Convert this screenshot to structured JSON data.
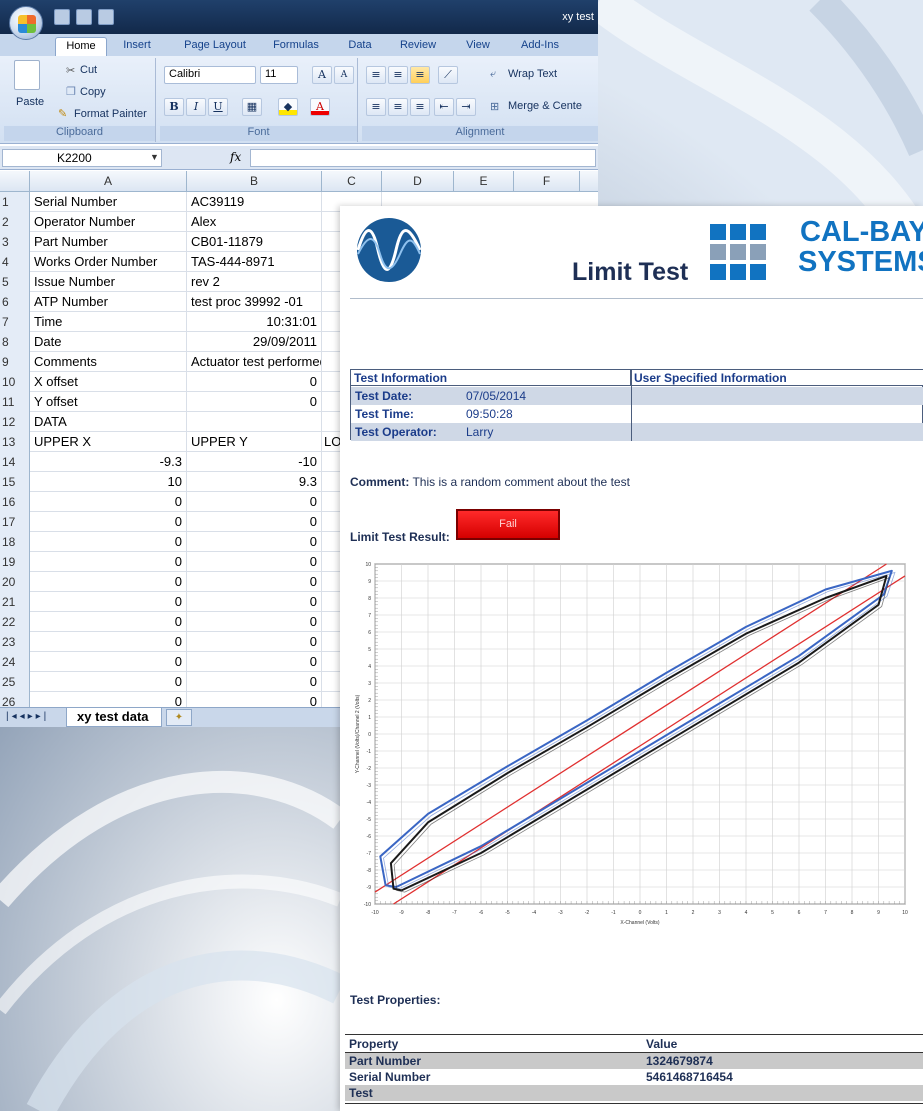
{
  "window": {
    "title": "xy test"
  },
  "ribbon": {
    "tabs": [
      "Home",
      "Insert",
      "Page Layout",
      "Formulas",
      "Data",
      "Review",
      "View",
      "Add-Ins"
    ],
    "clipboard": {
      "paste": "Paste",
      "cut": "Cut",
      "copy": "Copy",
      "format_painter": "Format Painter",
      "caption": "Clipboard"
    },
    "font": {
      "name": "Calibri",
      "size": "11",
      "caption": "Font"
    },
    "alignment": {
      "wrap_text": "Wrap Text",
      "merge": "Merge & Cente",
      "caption": "Alignment"
    }
  },
  "formula_bar": {
    "name_box": "K2200",
    "fx": "fx",
    "value": ""
  },
  "columns": [
    "A",
    "B",
    "C",
    "D",
    "E",
    "F"
  ],
  "rows": [
    {
      "n": "1",
      "a": "Serial Number",
      "b": "AC39119",
      "c": ""
    },
    {
      "n": "2",
      "a": "Operator Number",
      "b": "Alex",
      "c": ""
    },
    {
      "n": "3",
      "a": "Part Number",
      "b": "CB01-11879",
      "c": ""
    },
    {
      "n": "4",
      "a": "Works Order Number",
      "b": "TAS-444-8971",
      "c": ""
    },
    {
      "n": "5",
      "a": "Issue Number",
      "b": "rev 2",
      "c": ""
    },
    {
      "n": "6",
      "a": "ATP Number",
      "b": "test proc 39992 -01",
      "c": ""
    },
    {
      "n": "7",
      "a": "Time",
      "b": "10:31:01",
      "c": ""
    },
    {
      "n": "8",
      "a": "Date",
      "b": "29/09/2011",
      "c": ""
    },
    {
      "n": "9",
      "a": "Comments",
      "b": "Actuator test performed",
      "c": ""
    },
    {
      "n": "10",
      "a": "X offset",
      "b": "0",
      "c": ""
    },
    {
      "n": "11",
      "a": "Y offset",
      "b": "0",
      "c": ""
    },
    {
      "n": "12",
      "a": "DATA",
      "b": "",
      "c": ""
    },
    {
      "n": "13",
      "a": "UPPER X",
      "b": "UPPER Y",
      "c": "LO"
    },
    {
      "n": "14",
      "a": "-9.3",
      "b": "-10",
      "c": ""
    },
    {
      "n": "15",
      "a": "10",
      "b": "9.3",
      "c": ""
    },
    {
      "n": "16",
      "a": "0",
      "b": "0",
      "c": ""
    },
    {
      "n": "17",
      "a": "0",
      "b": "0",
      "c": ""
    },
    {
      "n": "18",
      "a": "0",
      "b": "0",
      "c": ""
    },
    {
      "n": "19",
      "a": "0",
      "b": "0",
      "c": ""
    },
    {
      "n": "20",
      "a": "0",
      "b": "0",
      "c": ""
    },
    {
      "n": "21",
      "a": "0",
      "b": "0",
      "c": ""
    },
    {
      "n": "22",
      "a": "0",
      "b": "0",
      "c": ""
    },
    {
      "n": "23",
      "a": "0",
      "b": "0",
      "c": ""
    },
    {
      "n": "24",
      "a": "0",
      "b": "0",
      "c": ""
    },
    {
      "n": "25",
      "a": "0",
      "b": "0",
      "c": ""
    },
    {
      "n": "26",
      "a": "0",
      "b": "0",
      "c": ""
    }
  ],
  "sheet_tab": "xy test data",
  "report": {
    "title": "Limit Test",
    "brand_line1": "CAL-BAY®",
    "brand_line2": "SYSTEMS",
    "info_header_left": "Test Information",
    "info_header_right": "User Specified Information",
    "test_date_label": "Test Date:",
    "test_date": "07/05/2014",
    "test_time_label": "Test Time:",
    "test_time": "09:50:28",
    "test_operator_label": "Test Operator:",
    "test_operator": "Larry",
    "comment_label": "Comment:",
    "comment": "This is a random comment about the test",
    "result_label": "Limit Test Result:",
    "result": "Fail",
    "properties_label": "Test Properties:",
    "properties_header": {
      "property": "Property",
      "value": "Value"
    },
    "properties": [
      {
        "property": "Part Number",
        "value": "1324679874"
      },
      {
        "property": "Serial Number",
        "value": "5461468716454"
      },
      {
        "property": "Test",
        "value": ""
      }
    ]
  },
  "chart_data": {
    "type": "line",
    "xlabel": "X-Channel (Volts)",
    "ylabel": "Y-Channel (Volts)/Channel 2 (Volts)",
    "xlim": [
      -10,
      10
    ],
    "ylim": [
      -10,
      10
    ],
    "x_ticks": [
      "-10",
      "-9",
      "-8",
      "-7",
      "-6",
      "-5",
      "-4",
      "-3",
      "-2",
      "-1",
      "0",
      "1",
      "2",
      "3",
      "4",
      "5",
      "6",
      "7",
      "8",
      "9",
      "10"
    ],
    "y_ticks": [
      "10",
      "9",
      "8",
      "7",
      "6",
      "5",
      "4",
      "3",
      "2",
      "1",
      "0",
      "-1",
      "-2",
      "-3",
      "-4",
      "-5",
      "-6",
      "-7",
      "-8",
      "-9",
      "-10"
    ],
    "grid": true,
    "series": [
      {
        "values": [
          [
            -9.3,
            -10
          ],
          [
            10,
            9.3
          ]
        ],
        "color": "#e03030"
      },
      {
        "values": [
          [
            -10,
            -9.3
          ],
          [
            9.3,
            10
          ]
        ],
        "color": "#e03030"
      },
      {
        "values": [
          [
            -9.2,
            -9.0
          ],
          [
            -6,
            -6.6
          ],
          [
            -3,
            -3.8
          ],
          [
            0,
            -1.0
          ],
          [
            3,
            1.8
          ],
          [
            6,
            4.6
          ],
          [
            9.2,
            8.2
          ],
          [
            9.5,
            9.6
          ],
          [
            7,
            8.5
          ],
          [
            4,
            6.3
          ],
          [
            1,
            3.6
          ],
          [
            -2,
            0.8
          ],
          [
            -5,
            -1.9
          ],
          [
            -8,
            -4.7
          ],
          [
            -9.8,
            -7.2
          ],
          [
            -9.6,
            -8.9
          ],
          [
            -9.2,
            -9.0
          ]
        ],
        "color": "#3a66c4"
      },
      {
        "values": [
          [
            -9.0,
            -9.2
          ],
          [
            -6,
            -7.0
          ],
          [
            -3,
            -4.2
          ],
          [
            0,
            -1.4
          ],
          [
            3,
            1.4
          ],
          [
            6,
            4.2
          ],
          [
            9.0,
            7.6
          ],
          [
            9.3,
            9.3
          ],
          [
            7,
            8.0
          ],
          [
            4,
            5.9
          ],
          [
            1,
            3.2
          ],
          [
            -2,
            0.4
          ],
          [
            -5,
            -2.3
          ],
          [
            -8,
            -5.2
          ],
          [
            -9.4,
            -7.6
          ],
          [
            -9.3,
            -9.1
          ],
          [
            -9.0,
            -9.2
          ]
        ],
        "color": "#1a1a1a"
      }
    ]
  }
}
